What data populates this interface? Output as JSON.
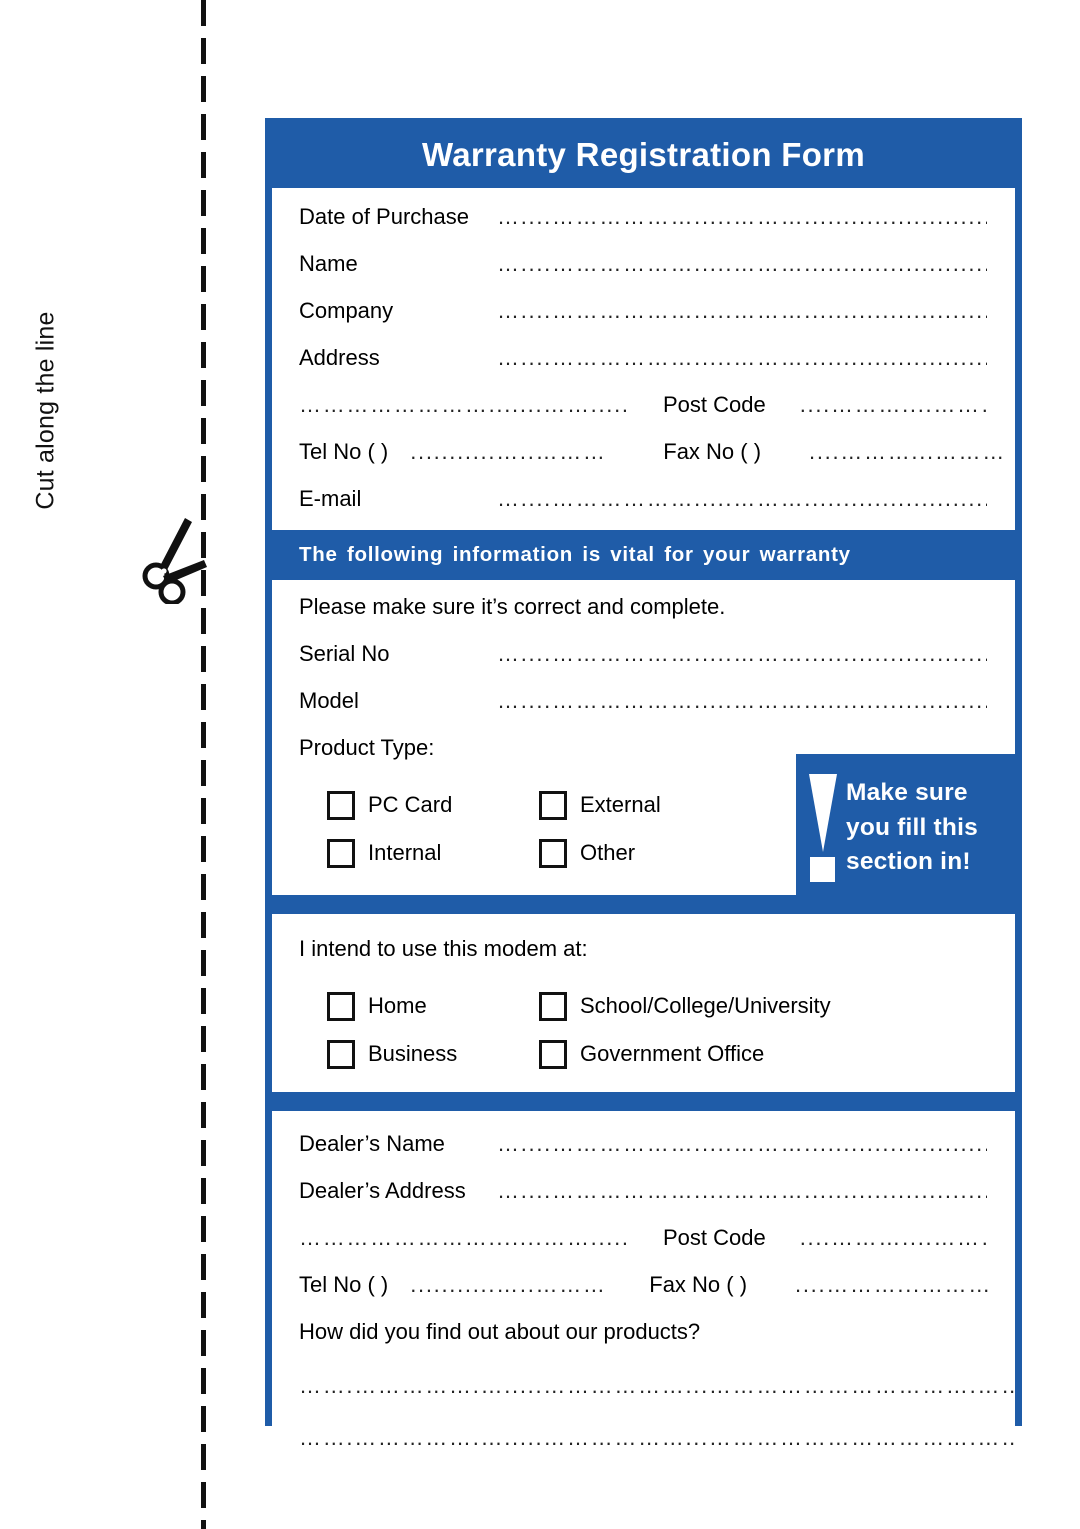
{
  "cut": {
    "label": "Cut along the line",
    "scissors_icon": "scissors-icon"
  },
  "form": {
    "title": "Warranty Registration Form",
    "customer_section": {
      "rows": [
        {
          "label": "Date of Purchase",
          "value": ""
        },
        {
          "label": "Name",
          "value": ""
        },
        {
          "label": "Company",
          "value": ""
        },
        {
          "label": "Address",
          "value": ""
        }
      ],
      "post_code_label": "Post Code",
      "tel_label": "Tel  No (      )",
      "fax_label": "Fax No (     )",
      "email_label": "E-mail",
      "email_value": ""
    },
    "warranty_banner": "The following information is vital for your warranty",
    "warranty_section": {
      "note": "Please make sure it’s correct and complete.",
      "rows": [
        {
          "label": "Serial No",
          "value": ""
        },
        {
          "label": "Model",
          "value": ""
        }
      ],
      "product_type_label": "Product Type:",
      "product_types": [
        {
          "label": "PC Card",
          "checked": false
        },
        {
          "label": "External",
          "checked": false
        },
        {
          "label": "Internal",
          "checked": false
        },
        {
          "label": "Other",
          "checked": false
        }
      ],
      "callout": {
        "icon": "exclamation-icon",
        "line1": "Make  sure",
        "line2": "you fill this",
        "line3": "section in!"
      }
    },
    "usage_section": {
      "question": "I intend to use this modem at:",
      "options": [
        {
          "label": "Home",
          "checked": false
        },
        {
          "label": "School/College/University",
          "checked": false
        },
        {
          "label": "Business",
          "checked": false
        },
        {
          "label": "Government  Office",
          "checked": false
        }
      ]
    },
    "dealer_section": {
      "rows": [
        {
          "label": "Dealer’s Name",
          "value": ""
        },
        {
          "label": "Dealer’s Address",
          "value": ""
        }
      ],
      "post_code_label": "Post Code",
      "tel_label": "Tel  No (     )",
      "fax_label": "Fax No (     )",
      "referral_question": "How did you find out about our products?",
      "answer_lines": [
        "",
        ""
      ]
    },
    "dots": {
      "full": "…....……………….....………....................................",
      "address": "…………………….......……...........",
      "post": "....………....……….",
      "tel": "...........…..………",
      "fax": "....………...……….",
      "long": "…….…………….….....………………...…………………………….……………………………….…...…………"
    },
    "colors": {
      "brand_blue": "#1F5CA8",
      "text_black": "#000000",
      "paper_white": "#FFFFFF"
    }
  }
}
